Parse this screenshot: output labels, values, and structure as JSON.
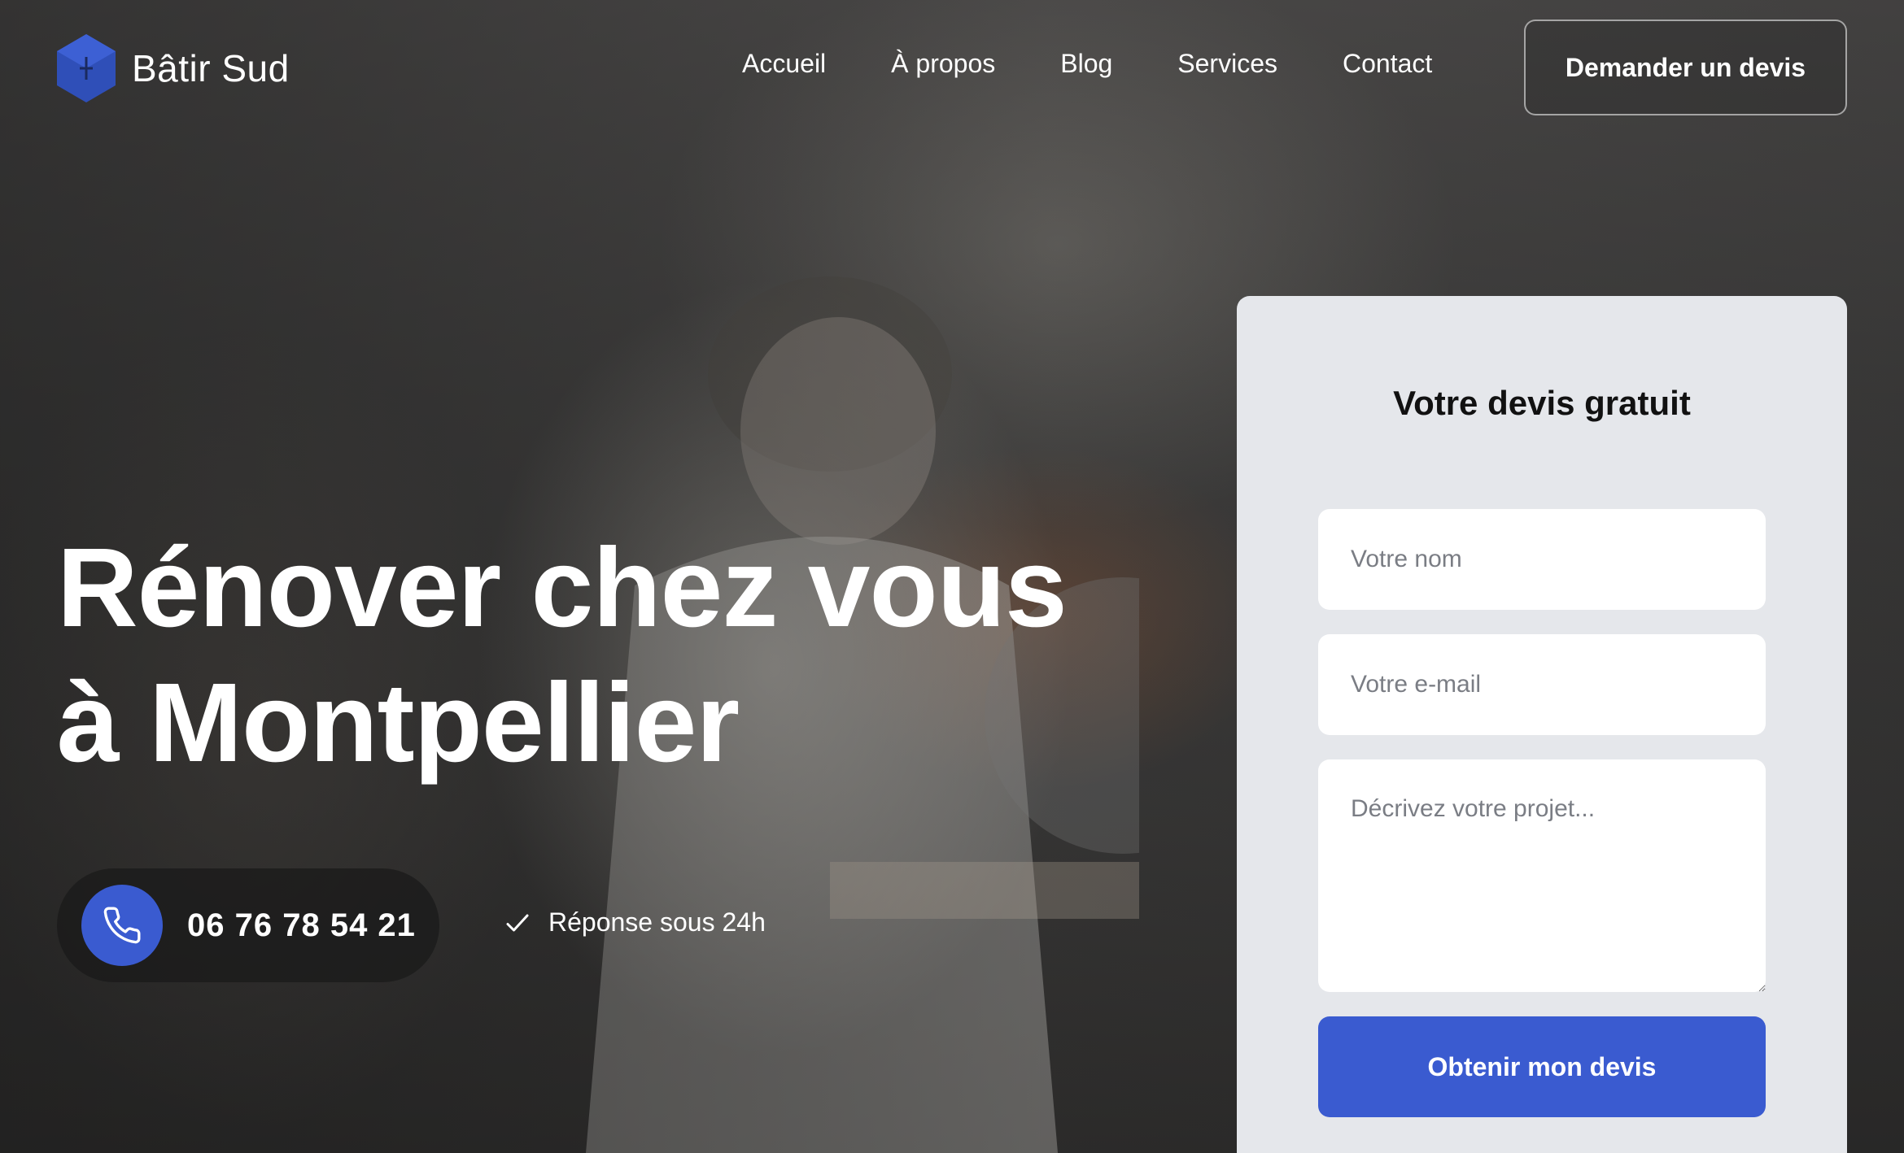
{
  "brand": {
    "name": "Bâtir Sud",
    "logo_icon": "hexagon-logo-icon",
    "accent": "#3a5bd0"
  },
  "nav": {
    "items": [
      {
        "label": "Accueil"
      },
      {
        "label": "À propos"
      },
      {
        "label": "Blog"
      },
      {
        "label": "Services"
      },
      {
        "label": "Contact"
      }
    ],
    "cta_label": "Demander un devis"
  },
  "hero": {
    "headline_line1": "Rénover chez vous",
    "headline_line2": "à Montpellier",
    "phone": {
      "icon": "phone-icon",
      "number": "06 76 78 54 21"
    },
    "response": {
      "icon": "check-icon",
      "text": "Réponse sous 24h"
    }
  },
  "quote_form": {
    "title": "Votre devis gratuit",
    "name_placeholder": "Votre nom",
    "email_placeholder": "Votre e-mail",
    "description_placeholder": "Décrivez votre projet...",
    "submit_label": "Obtenir mon devis"
  }
}
